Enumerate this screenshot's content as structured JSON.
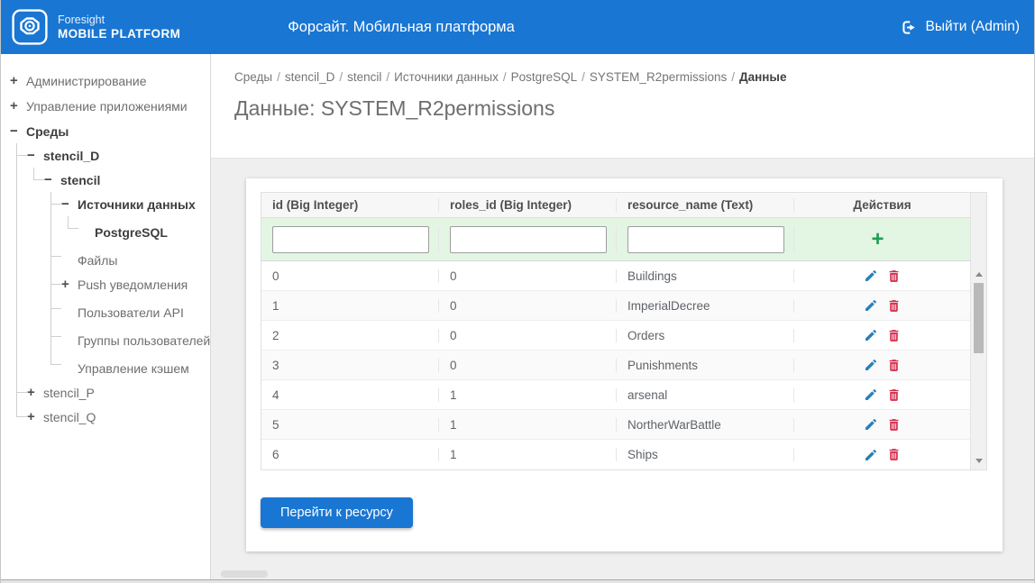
{
  "header": {
    "logo": {
      "line1": "Foresight",
      "line2": "MOBILE PLATFORM"
    },
    "title": "Форсайт. Мобильная платформа",
    "logout_label": "Выйти (Admin)"
  },
  "icons": {
    "plus": "+",
    "minus": "−"
  },
  "colors": {
    "header_bg": "#1976d2",
    "primary_button": "#1976d2",
    "add_green": "#1d9e50",
    "edit_blue": "#2980b9",
    "delete_red": "#d32f4e",
    "filter_row_bg": "#e2f6e3"
  },
  "sidebar": {
    "items": [
      {
        "label": "Администрирование",
        "state": "collapsed",
        "depth": 0
      },
      {
        "label": "Управление приложениями",
        "state": "collapsed",
        "depth": 0
      },
      {
        "label": "Среды",
        "state": "expanded",
        "depth": 0
      },
      {
        "label": "stencil_D",
        "state": "expanded",
        "depth": 1
      },
      {
        "label": "stencil",
        "state": "expanded",
        "depth": 2
      },
      {
        "label": "Источники данных",
        "state": "expanded",
        "depth": 3
      },
      {
        "label": "PostgreSQL",
        "state": "leaf",
        "depth": 4
      },
      {
        "label": "Файлы",
        "state": "leaf",
        "depth": 3
      },
      {
        "label": "Push уведомления",
        "state": "collapsed",
        "depth": 3
      },
      {
        "label": "Пользователи API",
        "state": "leaf",
        "depth": 3
      },
      {
        "label": "Группы пользователей",
        "state": "leaf",
        "depth": 3
      },
      {
        "label": "Управление кэшем",
        "state": "leaf",
        "depth": 3
      },
      {
        "label": "stencil_P",
        "state": "collapsed",
        "depth": 1
      },
      {
        "label": "stencil_Q",
        "state": "collapsed",
        "depth": 1
      }
    ]
  },
  "breadcrumb": {
    "separator": "/",
    "items": [
      "Среды",
      "stencil_D",
      "stencil",
      "Источники данных",
      "PostgreSQL",
      "SYSTEM_R2permissions",
      "Данные"
    ]
  },
  "page": {
    "title": "Данные: SYSTEM_R2permissions"
  },
  "table": {
    "columns": [
      "id (Big Integer)",
      "roles_id (Big Integer)",
      "resource_name (Text)",
      "Действия"
    ],
    "add_label": "+",
    "rows": [
      {
        "id": "0",
        "roles_id": "0",
        "resource_name": "Buildings"
      },
      {
        "id": "1",
        "roles_id": "0",
        "resource_name": "ImperialDecree"
      },
      {
        "id": "2",
        "roles_id": "0",
        "resource_name": "Orders"
      },
      {
        "id": "3",
        "roles_id": "0",
        "resource_name": "Punishments"
      },
      {
        "id": "4",
        "roles_id": "1",
        "resource_name": "arsenal"
      },
      {
        "id": "5",
        "roles_id": "1",
        "resource_name": "NortherWarBattle"
      },
      {
        "id": "6",
        "roles_id": "1",
        "resource_name": "Ships"
      }
    ]
  },
  "actions": {
    "goto_resource_label": "Перейти к ресурсу"
  }
}
